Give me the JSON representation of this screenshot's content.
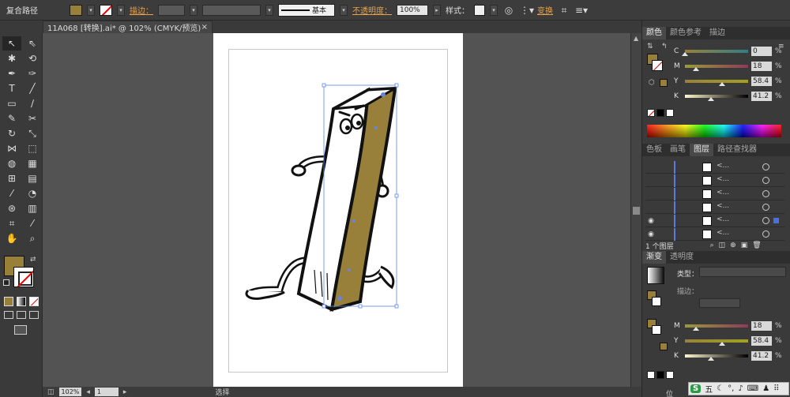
{
  "control_bar": {
    "mode_label": "复合路径",
    "fill_color": "#98803a",
    "stroke_label": "描边：",
    "stroke_profile": "基本",
    "opacity_label": "不透明度：",
    "opacity_value": "100%",
    "style_label": "样式：",
    "transform_label": "变换"
  },
  "document": {
    "tab_title": "11A068 [转换].ai* @ 102% (CMYK/预览)",
    "close_glyph": "×"
  },
  "toolbox": {
    "fill_color": "#98803a"
  },
  "color_panel": {
    "tabs": [
      "颜色",
      "颜色参考",
      "描边"
    ],
    "channels": [
      {
        "label": "C",
        "value": "0",
        "fraction": 0.0
      },
      {
        "label": "M",
        "value": "18",
        "fraction": 0.18
      },
      {
        "label": "Y",
        "value": "58.4",
        "fraction": 0.584
      },
      {
        "label": "K",
        "value": "41.2",
        "fraction": 0.412
      }
    ],
    "percent": "%",
    "current_color": "#98803a"
  },
  "layers_panel": {
    "tabs": [
      "色板",
      "画笔",
      "图层",
      "路径查找器"
    ],
    "active_tab": "图层",
    "row_glyph": "<...",
    "row_count": 6,
    "footer_label": "1 个图层"
  },
  "gradient_panel": {
    "tabs": [
      "渐变",
      "透明度"
    ],
    "type_label": "类型：",
    "stroke_label": "描边：",
    "channels": [
      {
        "label": "M",
        "value": "18",
        "fraction": 0.18
      },
      {
        "label": "Y",
        "value": "58.4",
        "fraction": 0.584
      },
      {
        "label": "K",
        "value": "41.2",
        "fraction": 0.412
      }
    ],
    "position_label": "位"
  },
  "status_bar": {
    "zoom": "102%",
    "page": "1",
    "selection_label": "选择"
  },
  "ime_bar": {
    "logo": "S",
    "label": "五"
  }
}
